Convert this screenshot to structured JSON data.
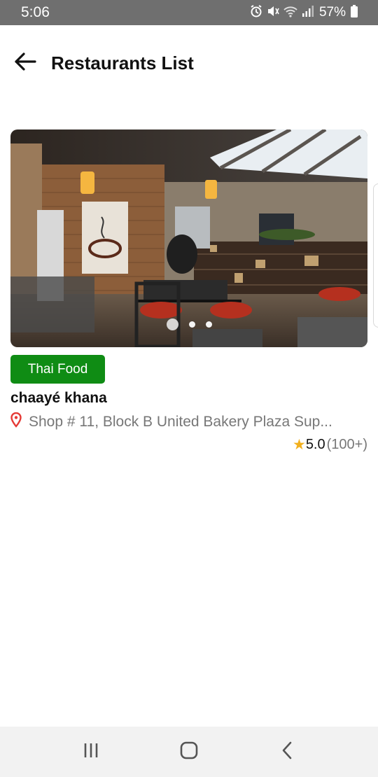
{
  "status_bar": {
    "time": "5:06",
    "battery": "57%",
    "icons": [
      "alarm-icon",
      "mute-icon",
      "wifi-icon",
      "signal-icon",
      "battery-icon"
    ]
  },
  "app_bar": {
    "back_icon": "arrow-left-icon",
    "title": "Restaurants List"
  },
  "restaurants": [
    {
      "tag": "Thai Food",
      "tag_color": "#0f8c14",
      "name": "chaayé khana",
      "address": "Shop # 11, Block B United Bakery Plaza Sup...",
      "rating": "5.0",
      "rating_count": "(100+)",
      "rating_star_color": "#f2b01e",
      "carousel": {
        "slides": 3,
        "active_slide": 1
      }
    }
  ],
  "nav_bar": {
    "recents_icon": "recents-icon",
    "home_icon": "home-icon",
    "back_icon": "back-chevron-icon"
  }
}
